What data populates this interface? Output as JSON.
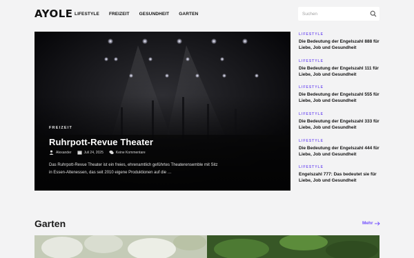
{
  "header": {
    "logo": "AYOLE",
    "nav": [
      "LIFESTYLE",
      "FREIZEIT",
      "GESUNDHEIT",
      "GARTEN"
    ],
    "search_placeholder": "Suchen"
  },
  "hero": {
    "category": "FREIZEIT",
    "title": "Ruhrpott-Revue Theater",
    "author": "Alexander",
    "date": "Juli 24, 2025",
    "comments": "Keine Kommentare",
    "excerpt": "Das Ruhrpott-Revue Theater ist ein freies, ehrenamtlich geführtes Theaterensemble mit Sitz in Essen-Altenessen, das seit 2010 eigene Produktionen auf die …"
  },
  "sidebar": {
    "items": [
      {
        "category": "LIFESTYLE",
        "title": "Die Bedeutung der Engelszahl 888 für Liebe, Job und Gesundheit"
      },
      {
        "category": "LIFESTYLE",
        "title": "Die Bedeutung der Engelszahl 111 für Liebe, Job und Gesundheit"
      },
      {
        "category": "LIFESTYLE",
        "title": "Die Bedeutung der Engelszahl 555 für Liebe, Job und Gesundheit"
      },
      {
        "category": "LIFESTYLE",
        "title": "Die Bedeutung der Engelszahl 333 für Liebe, Job und Gesundheit"
      },
      {
        "category": "LIFESTYLE",
        "title": "Die Bedeutung der Engelszahl 444 für Liebe, Job und Gesundheit"
      },
      {
        "category": "LIFESTYLE",
        "title": "Engelszahl 777: Das bedeutet sie für Liebe, Job und Gesundheit"
      }
    ]
  },
  "section": {
    "title": "Garten",
    "more_label": "Mehr"
  },
  "colors": {
    "accent": "#7b5cf0",
    "background": "#f3f3f4",
    "text": "#111111"
  },
  "icons": {
    "search": "search-icon",
    "author": "user-icon",
    "date": "calendar-icon",
    "comments": "comments-icon",
    "more": "arrow-right-icon"
  }
}
